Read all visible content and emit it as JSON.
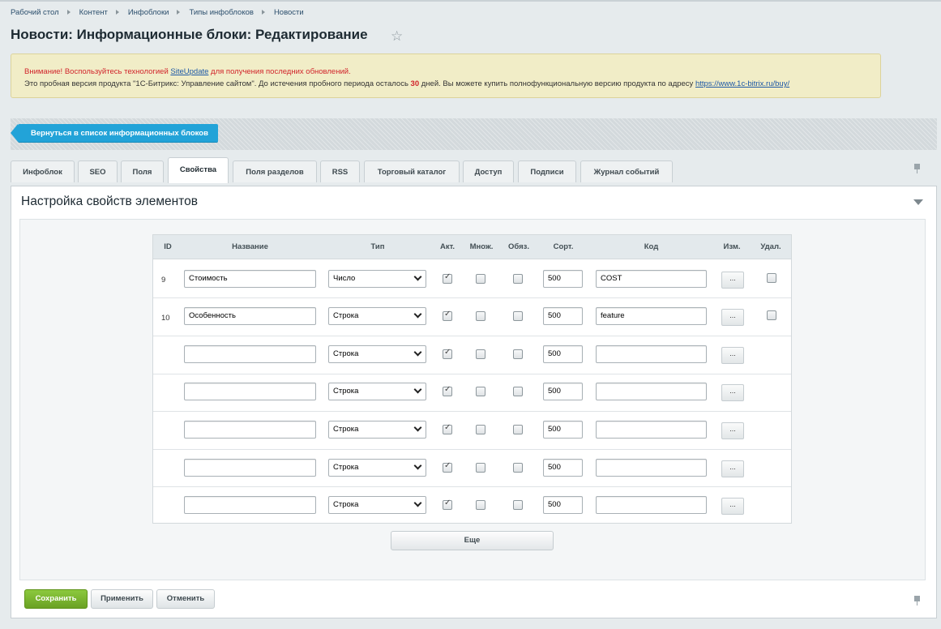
{
  "breadcrumbs": [
    "Рабочий стол",
    "Контент",
    "Инфоблоки",
    "Типы инфоблоков",
    "Новости"
  ],
  "page_title": "Новости: Информационные блоки: Редактирование",
  "warning": {
    "line1_prefix": "Внимание! Воспользуйтесь технологией ",
    "line1_link": "SiteUpdate",
    "line1_suffix": " для получения последних обновлений.",
    "line2_prefix": "Это пробная версия продукта \"1С-Битрикс: Управление сайтом\". До истечения пробного периода осталось ",
    "line2_days": "30",
    "line2_mid": " дней. Вы можете купить полнофункциональную версию продукта по адресу ",
    "line2_link": "https://www.1c-bitrix.ru/buy/"
  },
  "back_button": "Вернуться в список информационных блоков",
  "tabs": [
    "Инфоблок",
    "SEO",
    "Поля",
    "Свойства",
    "Поля разделов",
    "RSS",
    "Торговый каталог",
    "Доступ",
    "Подписи",
    "Журнал событий"
  ],
  "active_tab": "Свойства",
  "section_title": "Настройка свойств элементов",
  "table": {
    "headers": [
      "ID",
      "Название",
      "Тип",
      "Акт.",
      "Множ.",
      "Обяз.",
      "Сорт.",
      "Код",
      "Изм.",
      "Удал."
    ],
    "rows": [
      {
        "id": "9",
        "name": "Стоимость",
        "type": "Число",
        "active": true,
        "multiple": false,
        "required": false,
        "sort": "500",
        "code": "COST",
        "edit": "...",
        "has_delete": true
      },
      {
        "id": "10",
        "name": "Особенность",
        "type": "Строка",
        "active": true,
        "multiple": false,
        "required": false,
        "sort": "500",
        "code": "feature",
        "edit": "...",
        "has_delete": true
      },
      {
        "id": "",
        "name": "",
        "type": "Строка",
        "active": true,
        "multiple": false,
        "required": false,
        "sort": "500",
        "code": "",
        "edit": "...",
        "has_delete": false
      },
      {
        "id": "",
        "name": "",
        "type": "Строка",
        "active": true,
        "multiple": false,
        "required": false,
        "sort": "500",
        "code": "",
        "edit": "...",
        "has_delete": false
      },
      {
        "id": "",
        "name": "",
        "type": "Строка",
        "active": true,
        "multiple": false,
        "required": false,
        "sort": "500",
        "code": "",
        "edit": "...",
        "has_delete": false
      },
      {
        "id": "",
        "name": "",
        "type": "Строка",
        "active": true,
        "multiple": false,
        "required": false,
        "sort": "500",
        "code": "",
        "edit": "...",
        "has_delete": false
      },
      {
        "id": "",
        "name": "",
        "type": "Строка",
        "active": true,
        "multiple": false,
        "required": false,
        "sort": "500",
        "code": "",
        "edit": "...",
        "has_delete": false
      }
    ]
  },
  "more_button": "Еще",
  "buttons": {
    "save": "Сохранить",
    "apply": "Применить",
    "cancel": "Отменить"
  },
  "colors": {
    "accent_blue": "#22a3d8",
    "save_green": "#6aa123",
    "warning_red": "#d1242b"
  }
}
